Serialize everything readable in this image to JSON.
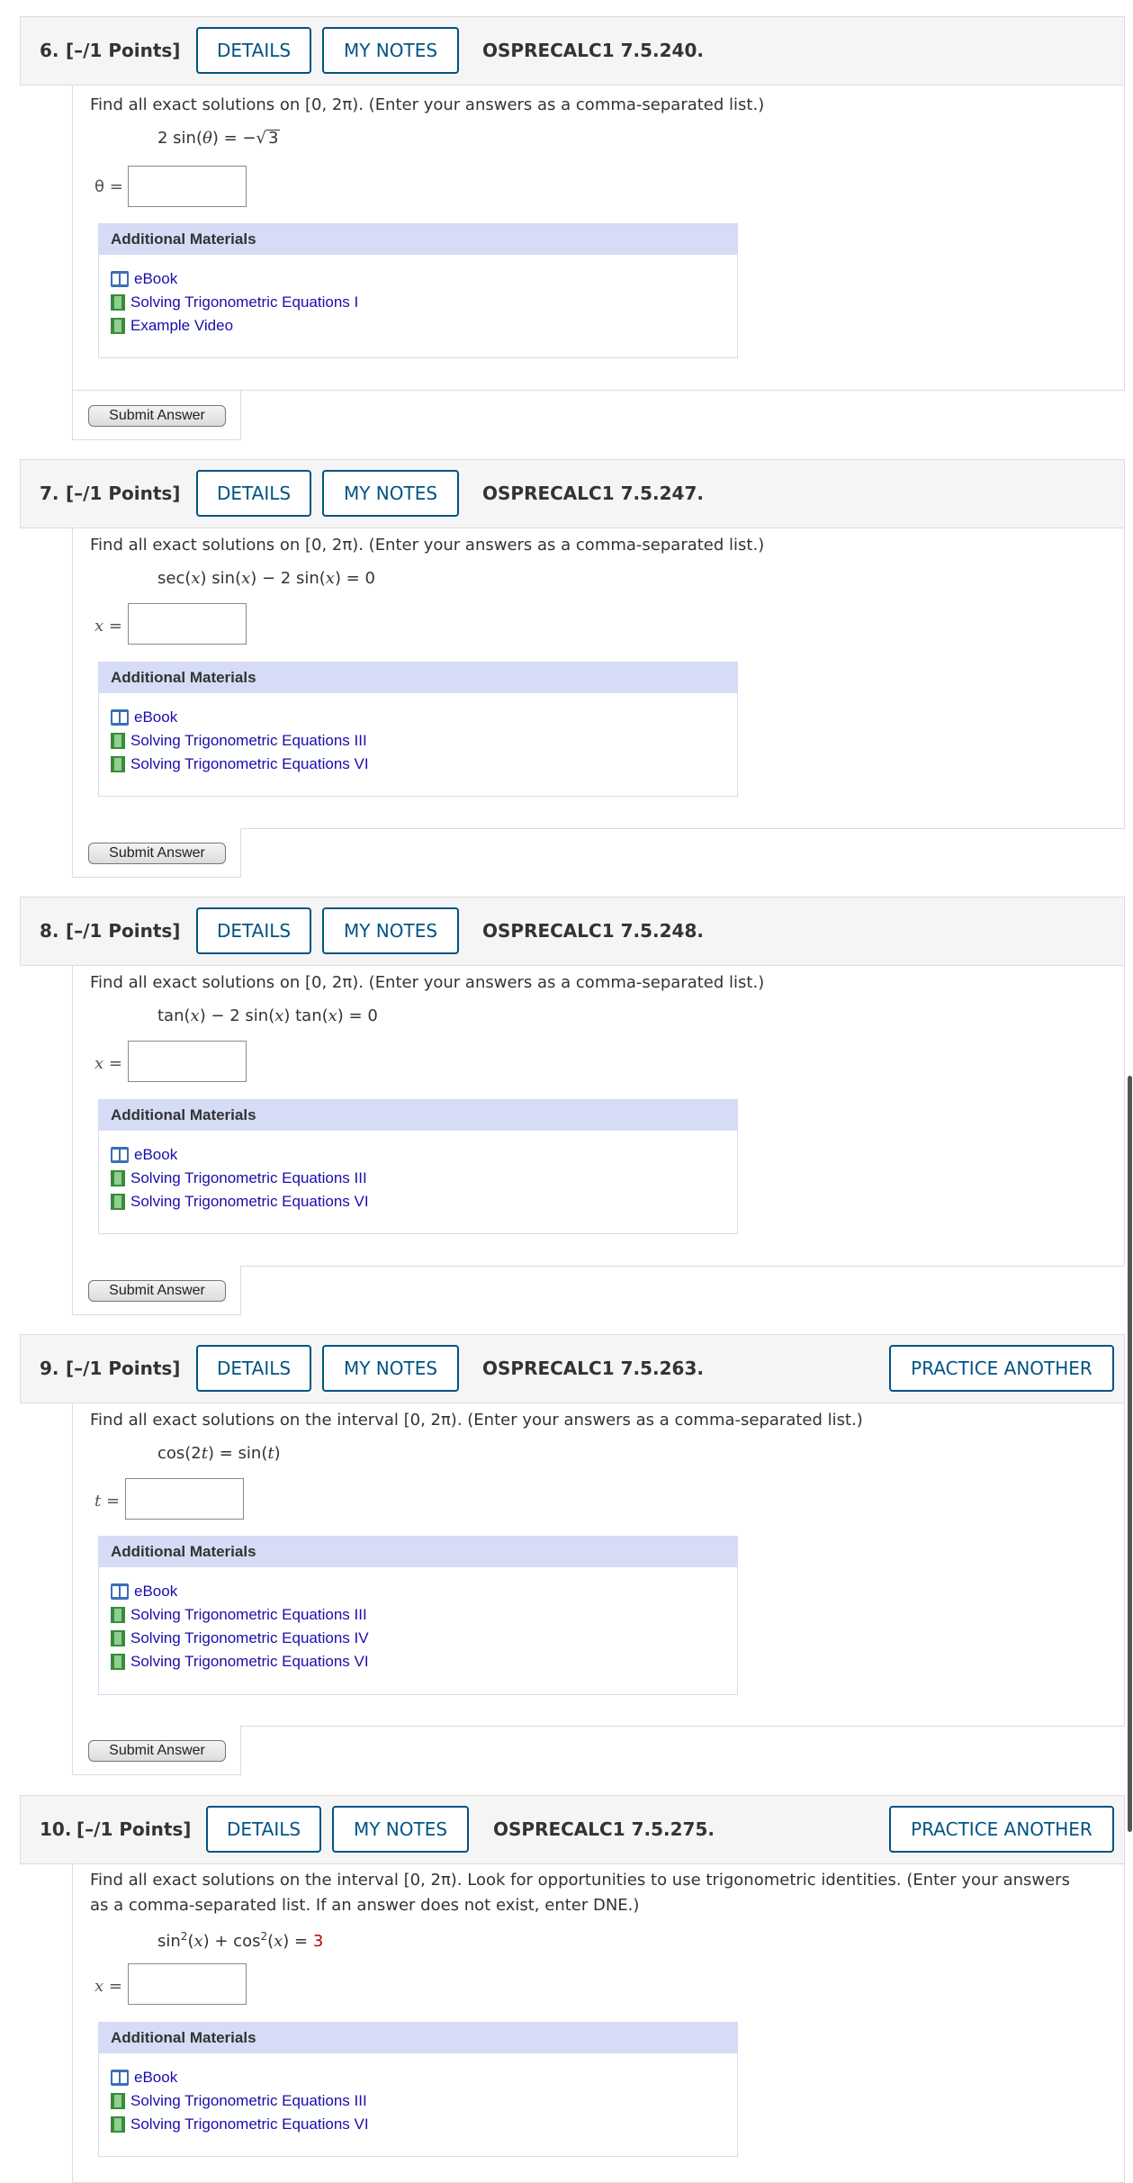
{
  "header_buttons": {
    "details": "DETAILS",
    "my_notes": "MY NOTES",
    "practice": "PRACTICE ANOTHER"
  },
  "materials_title": "Additional Materials",
  "submit_label": "Submit Answer",
  "questions": [
    {
      "number": "6.",
      "points": "[–/1 Points]",
      "code": "OSPRECALC1 7.5.240.",
      "prompt": "Find all exact solutions on  [0, 2π).  (Enter your answers as a comma-separated list.)",
      "equation": "2 sin(θ) = −√3",
      "variable": "θ =",
      "answer": "",
      "materials": [
        "eBook",
        "Solving Trigonometric Equations I",
        "Example Video"
      ]
    },
    {
      "number": "7.",
      "points": "[–/1 Points]",
      "code": "OSPRECALC1 7.5.247.",
      "prompt": "Find all exact solutions on  [0, 2π).  (Enter your answers as a comma-separated list.)",
      "equation": "sec(x) sin(x) − 2 sin(x) = 0",
      "variable": "x =",
      "answer": "",
      "materials": [
        "eBook",
        "Solving Trigonometric Equations III",
        "Solving Trigonometric Equations VI"
      ]
    },
    {
      "number": "8.",
      "points": "[–/1 Points]",
      "code": "OSPRECALC1 7.5.248.",
      "prompt": "Find all exact solutions on  [0, 2π).  (Enter your answers as a comma-separated list.)",
      "equation": "tan(x) − 2 sin(x) tan(x) = 0",
      "variable": "x =",
      "answer": "",
      "materials": [
        "eBook",
        "Solving Trigonometric Equations III",
        "Solving Trigonometric Equations VI"
      ]
    },
    {
      "number": "9.",
      "points": "[–/1 Points]",
      "code": "OSPRECALC1 7.5.263.",
      "prompt": "Find all exact solutions on the interval  [0, 2π).  (Enter your answers as a comma-separated list.)",
      "equation": "cos(2t) = sin(t)",
      "variable": "t =",
      "answer": "",
      "materials": [
        "eBook",
        "Solving Trigonometric Equations III",
        "Solving Trigonometric Equations IV",
        "Solving Trigonometric Equations VI"
      ]
    },
    {
      "number": "10.",
      "points": "[–/1 Points]",
      "code": "OSPRECALC1 7.5.275.",
      "prompt": "Find all exact solutions on the interval  [0, 2π).  Look for opportunities to use trigonometric identities. (Enter your answers as a comma-separated list. If an answer does not exist, enter DNE.)",
      "equation": "sin²(x) + cos²(x) = ",
      "equation_rhs": "3",
      "variable": "x =",
      "answer": "",
      "materials": [
        "eBook",
        "Solving Trigonometric Equations III",
        "Solving Trigonometric Equations VI"
      ]
    }
  ],
  "colors": {
    "accent": "#005383",
    "materials_header": "#d6dcf5",
    "link": "#1a0dab",
    "highlight": "#c00000"
  }
}
